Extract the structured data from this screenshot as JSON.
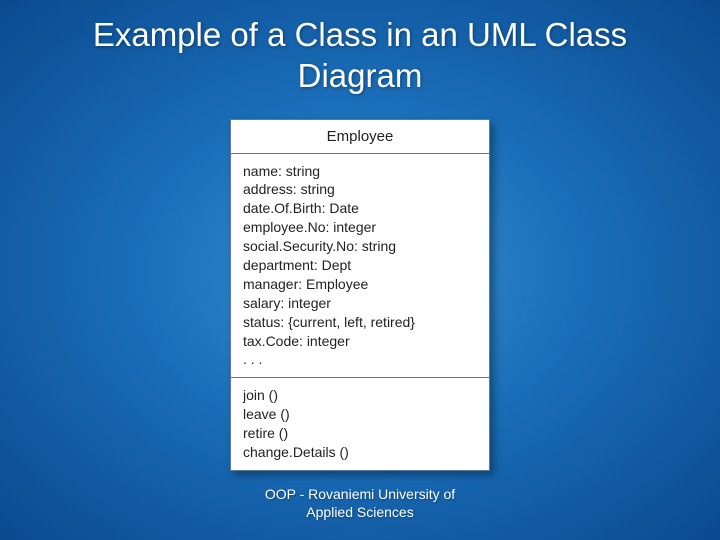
{
  "title": "Example of a Class in an UML Class Diagram",
  "uml": {
    "className": "Employee",
    "attributes": [
      "name: string",
      "address: string",
      "date.Of.Birth: Date",
      "employee.No: integer",
      "social.Security.No: string",
      "department: Dept",
      "manager: Employee",
      "salary: integer",
      "status:  {current, left, retired}",
      "tax.Code: integer",
      ". . ."
    ],
    "operations": [
      "join ()",
      "leave ()",
      "retire ()",
      "change.Details ()"
    ]
  },
  "footer": {
    "line1": "OOP - Rovaniemi University of",
    "line2": "Applied Sciences"
  }
}
